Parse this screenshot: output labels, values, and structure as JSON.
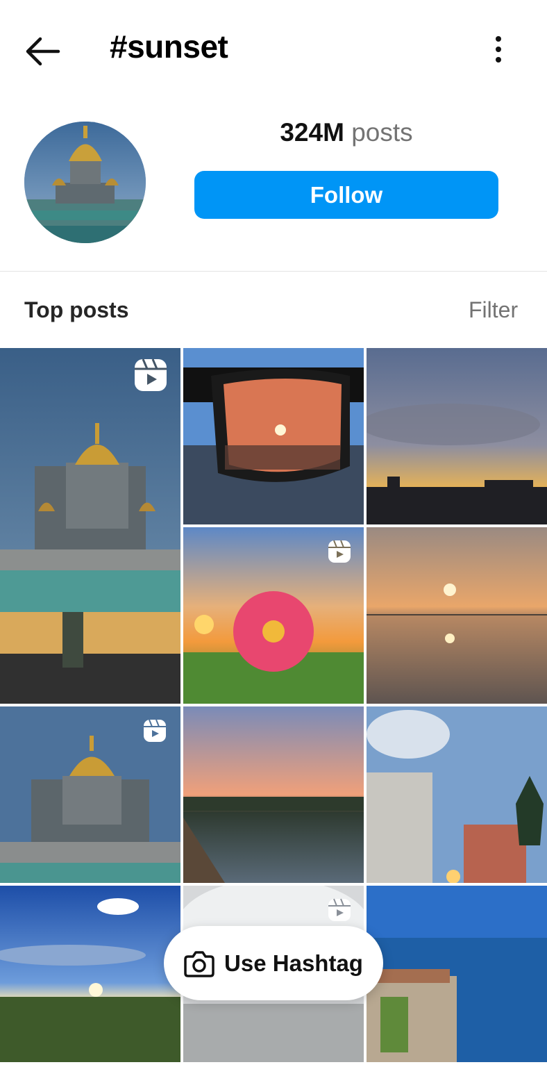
{
  "header": {
    "title": "#sunset",
    "back_icon": "arrow-left-icon",
    "more_icon": "vertical-dots-icon"
  },
  "profile": {
    "posts_count": "324M",
    "posts_label": "posts",
    "follow_label": "Follow",
    "follow_color": "#0095f6"
  },
  "section": {
    "title": "Top posts",
    "filter_label": "Filter"
  },
  "posts": [
    {
      "subject": "cathedral dome at dusk over rooftops",
      "reel": true
    },
    {
      "subject": "sunset seen through sunglasses lens",
      "reel": false
    },
    {
      "subject": "cloudy sky over city skyline at sunset",
      "reel": false
    },
    {
      "subject": "pink flower with butterfly at sunset",
      "reel": true
    },
    {
      "subject": "misty sun reflected on water",
      "reel": false
    },
    {
      "subject": "cathedral dome at dusk",
      "reel": true
    },
    {
      "subject": "beach shoreline at sunset",
      "reel": false
    },
    {
      "subject": "street with buildings and sunset",
      "reel": false
    },
    {
      "subject": "sun over fields under blue sky",
      "reel": false
    },
    {
      "subject": "misty waterfall",
      "reel": true
    },
    {
      "subject": "seaside terrace by blue sea",
      "reel": false
    }
  ],
  "fab": {
    "label": "Use Hashtag",
    "icon": "camera-icon"
  }
}
